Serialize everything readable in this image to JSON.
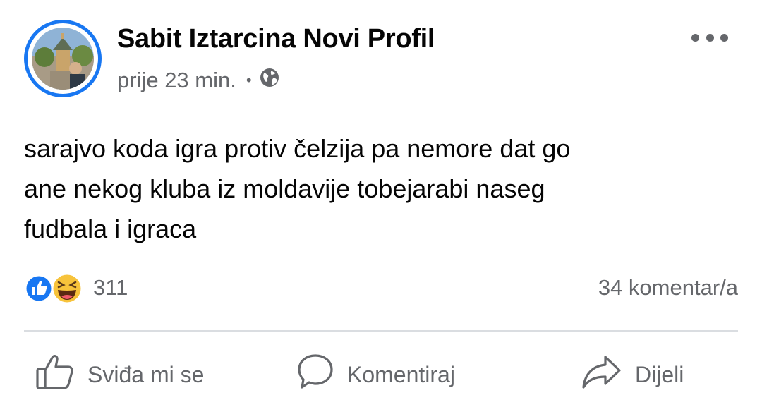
{
  "post": {
    "author": "Sabit Iztarcina Novi Profil",
    "timestamp": "prije 23 min.",
    "separator": "•",
    "privacy_icon": "globe-icon",
    "more_icon": "more-options-icon",
    "text_lines": [
      "sarajvo koda igra protiv čelzija pa nemore dat go",
      "ane nekog kluba iz moldavije tobejarabi naseg",
      "fudbala i igraca"
    ]
  },
  "reactions": {
    "icons": [
      "like-reaction-icon",
      "haha-reaction-icon"
    ],
    "count": "311",
    "comments": "34 komentar/a"
  },
  "actions": {
    "like": "Sviđa mi se",
    "comment": "Komentiraj",
    "share": "Dijeli"
  },
  "colors": {
    "accent": "#1877f2",
    "secondary_text": "#65676b",
    "divider": "#dadde1"
  }
}
